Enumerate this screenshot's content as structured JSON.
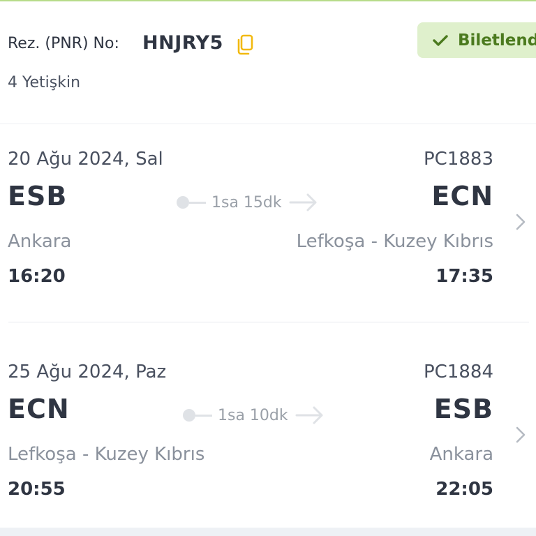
{
  "booking": {
    "pnr_label": "Rez. (PNR) No:",
    "pnr_value": "HNJRY5",
    "status": "Biletlend",
    "passengers": "4 Yetişkin"
  },
  "flights": [
    {
      "date": "20 Ağu 2024, Sal",
      "flight_no": "PC1883",
      "from_code": "ESB",
      "to_code": "ECN",
      "duration": "1sa 15dk",
      "from_city": "Ankara",
      "to_city": "Lefkoşa - Kuzey Kıbrıs",
      "dep_time": "16:20",
      "arr_time": "17:35"
    },
    {
      "date": "25 Ağu 2024, Paz",
      "flight_no": "PC1884",
      "from_code": "ECN",
      "to_code": "ESB",
      "duration": "1sa 10dk",
      "from_city": "Lefkoşa - Kuzey Kıbrıs",
      "to_city": "Ankara",
      "dep_time": "20:55",
      "arr_time": "22:05"
    }
  ],
  "colors": {
    "status_bg": "#dff0cc",
    "status_text": "#4b7a1e",
    "copy_icon": "#f2b90f",
    "text_primary": "#2f3542",
    "text_muted": "#8a919c"
  },
  "icons": {
    "copy": "copy-icon",
    "status": "check-icon",
    "route_arrow": "arrow-right-icon",
    "row_chevron": "chevron-right-icon"
  }
}
